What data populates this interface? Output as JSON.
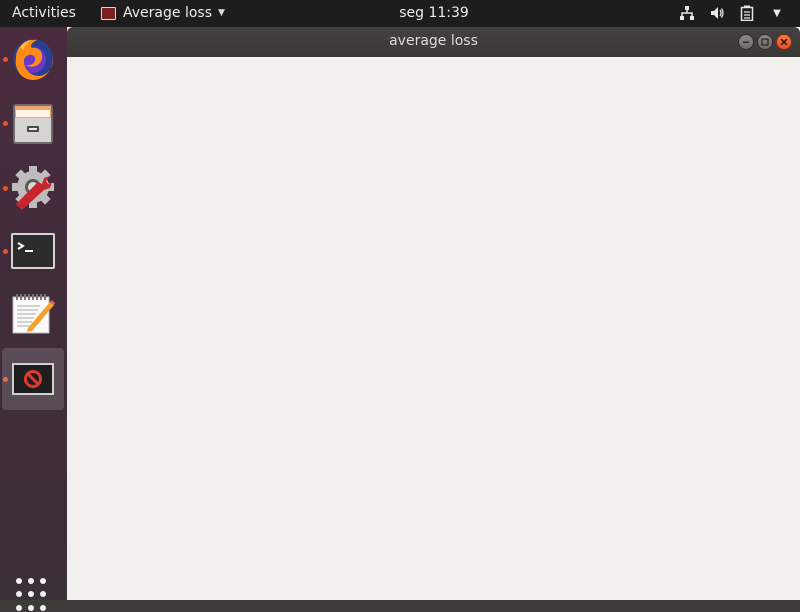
{
  "topbar": {
    "activities_label": "Activities",
    "app_menu_label": "Average loss",
    "clock": "seg 11:39",
    "tray_icons": [
      "network-icon",
      "volume-icon",
      "battery-icon",
      "system-menu-caret-icon"
    ]
  },
  "dock": {
    "items": [
      {
        "name": "firefox",
        "running": true
      },
      {
        "name": "files",
        "running": true
      },
      {
        "name": "settings",
        "running": true
      },
      {
        "name": "terminal",
        "running": true
      },
      {
        "name": "text-editor",
        "running": false
      },
      {
        "name": "average-loss-app",
        "running": true,
        "active": true
      }
    ],
    "show_apps_icon": "app-grid-icon"
  },
  "window": {
    "title": "average loss",
    "buttons": [
      "minimize",
      "maximize",
      "close"
    ]
  },
  "colors": {
    "topbar_bg": "#1d1d1d",
    "dock_bg": "#3e2d39",
    "accent": "#e95420",
    "window_bg": "#f2f1f0",
    "titlebar_bg": "#3c3b37"
  }
}
